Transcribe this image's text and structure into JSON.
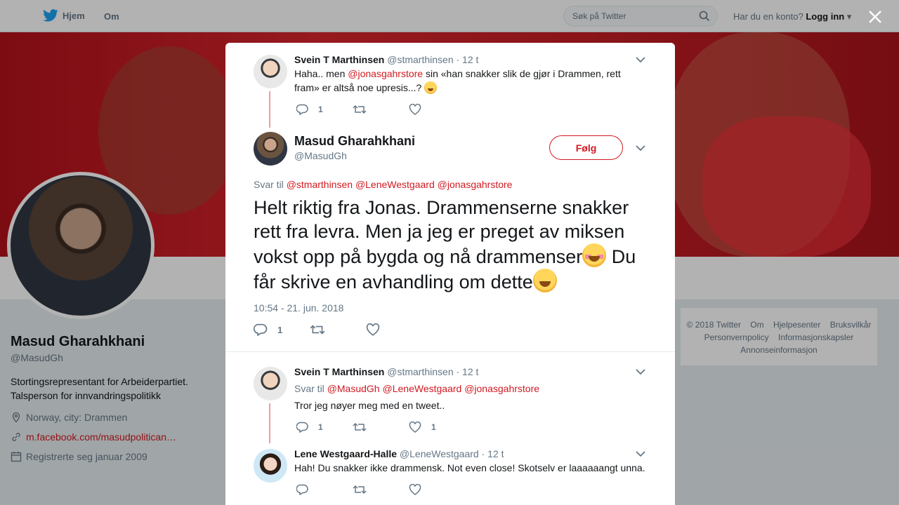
{
  "topnav": {
    "home_label": "Hjem",
    "about_label": "Om",
    "search_placeholder": "Søk på Twitter",
    "account_prompt": "Har du en konto?",
    "login_label": "Logg inn"
  },
  "profile": {
    "name": "Masud Gharahkhani",
    "handle": "@MasudGh",
    "bio": "Stortingsrepresentant for Arbeiderpartiet. Talsperson for innvandringspolitikk",
    "location": "Norway, city: Drammen",
    "link": "m.facebook.com/masudpolitican…",
    "joined": "Registrerte seg januar 2009"
  },
  "footer": {
    "line1": [
      "© 2018 Twitter",
      "Om",
      "Hjelpesenter",
      "Bruksvilkår"
    ],
    "line2": [
      "Personvernpolicy",
      "Informasjonskapsler"
    ],
    "line3": [
      "Annonseinformasjon"
    ]
  },
  "tweets": {
    "parent": {
      "name": "Svein T Marthinsen",
      "handle": "@stmarthinsen",
      "time": "· 12 t",
      "text_before": "Haha.. men ",
      "mention": "@jonasgahrstore",
      "text_after": " sin «han snakker slik de gjør i Drammen, rett fram» er altså noe upresis...?",
      "reply_count": "1"
    },
    "main": {
      "name": "Masud Gharahkhani",
      "handle": "@MasudGh",
      "follow_label": "Følg",
      "reply_to_label": "Svar til",
      "mentions": [
        "@stmarthinsen",
        "@LeneWestgaard",
        "@jonasgahrstore"
      ],
      "text_part1": "Helt riktig fra Jonas. Drammenserne snakker rett fra levra. Men ja jeg er preget av miksen vokst opp på bygda og nå drammenser",
      "text_part2": " Du får skrive en avhandling om dette",
      "timestamp": "10:54 - 21. jun. 2018",
      "reply_count": "1"
    },
    "reply1": {
      "name": "Svein T Marthinsen",
      "handle": "@stmarthinsen",
      "time": "· 12 t",
      "reply_to_label": "Svar til",
      "mentions": [
        "@MasudGh",
        "@LeneWestgaard",
        "@jonasgahrstore"
      ],
      "text": "Tror jeg nøyer meg med en tweet..",
      "reply_count": "1",
      "like_count": "1"
    },
    "reply2": {
      "name": "Lene Westgaard-Halle",
      "handle": "@LeneWestgaard",
      "time": "· 12 t",
      "text": "Hah! Du snakker ikke drammensk. Not even close! Skotselv er laaaaaangt unna."
    }
  },
  "colors": {
    "accent": "#d11a22",
    "thread_line": "#f59a9e",
    "muted": "#657786"
  }
}
